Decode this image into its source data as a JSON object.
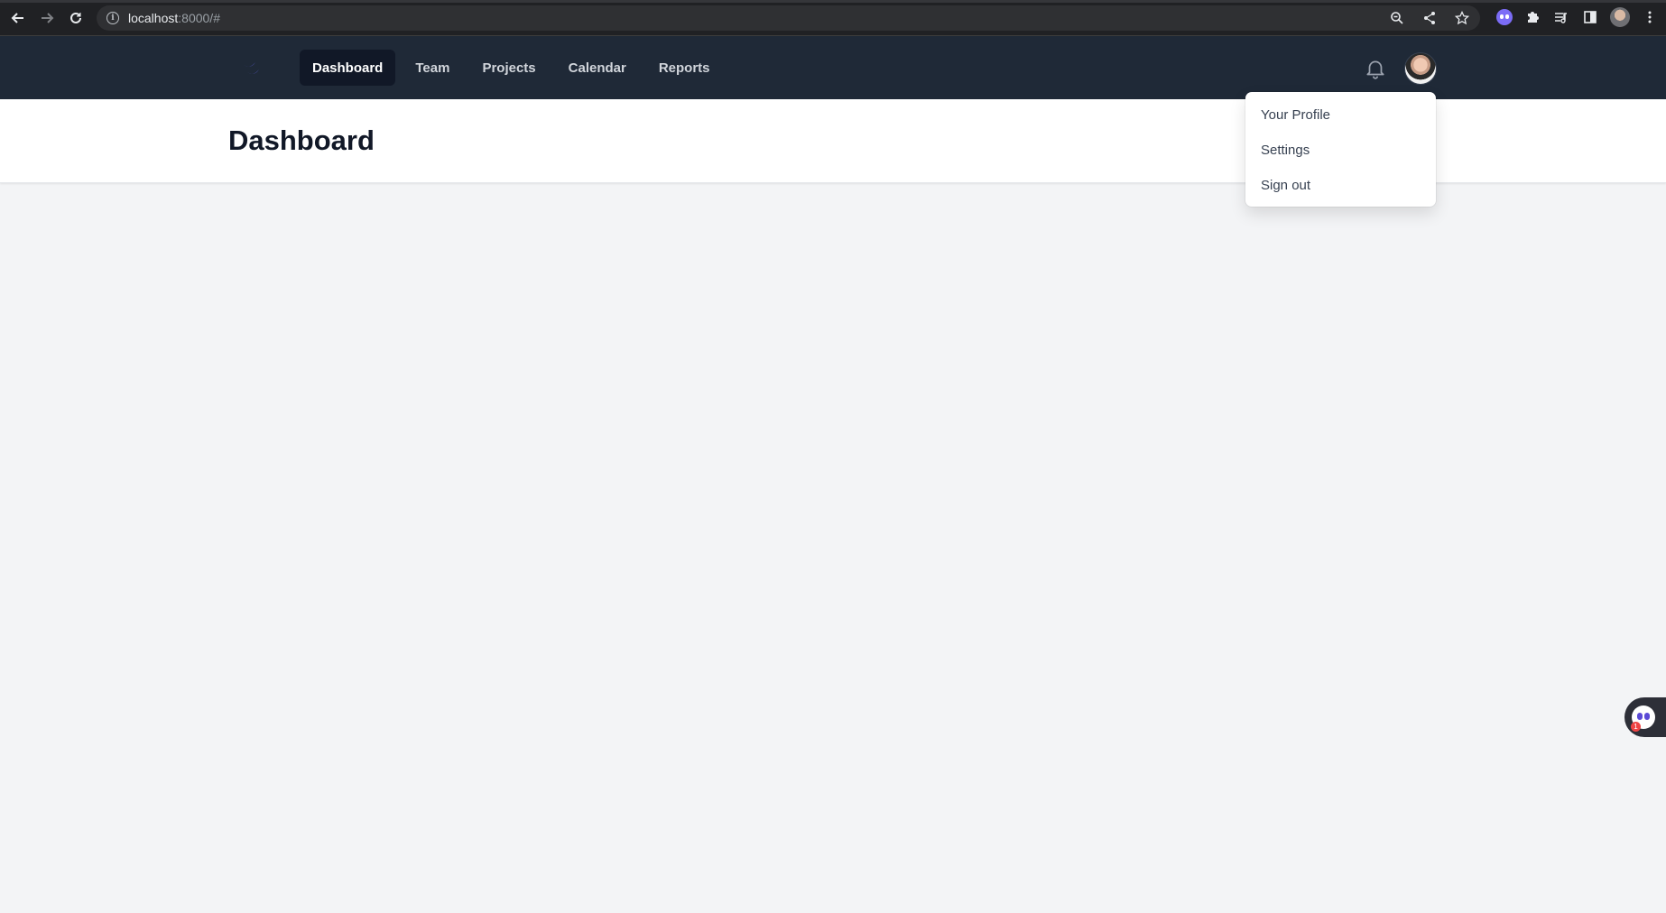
{
  "browser": {
    "url_host": "localhost",
    "url_rest": ":8000/#",
    "icons": [
      "back-arrow-icon",
      "forward-arrow-icon",
      "reload-icon",
      "info-icon",
      "zoom-icon",
      "share-icon",
      "star-icon",
      "extension-ghost-icon",
      "puzzle-icon",
      "media-icon",
      "sidepanel-icon",
      "profile-avatar",
      "kebab-menu-icon"
    ]
  },
  "navbar": {
    "links": [
      {
        "label": "Dashboard",
        "active": true
      },
      {
        "label": "Team",
        "active": false
      },
      {
        "label": "Projects",
        "active": false
      },
      {
        "label": "Calendar",
        "active": false
      },
      {
        "label": "Reports",
        "active": false
      }
    ],
    "icons": {
      "logo": "tailwind-logo-icon",
      "notifications": "bell-icon",
      "avatar": "user-avatar"
    }
  },
  "header": {
    "title": "Dashboard"
  },
  "profile_menu": {
    "items": [
      {
        "label": "Your Profile"
      },
      {
        "label": "Settings"
      },
      {
        "label": "Sign out"
      }
    ]
  },
  "floating_widget": {
    "badge": "1"
  },
  "colors": {
    "navbar": "#1f2937",
    "nav_active": "#111827",
    "page_bg": "#f3f4f6",
    "logo": "#6366f1"
  }
}
